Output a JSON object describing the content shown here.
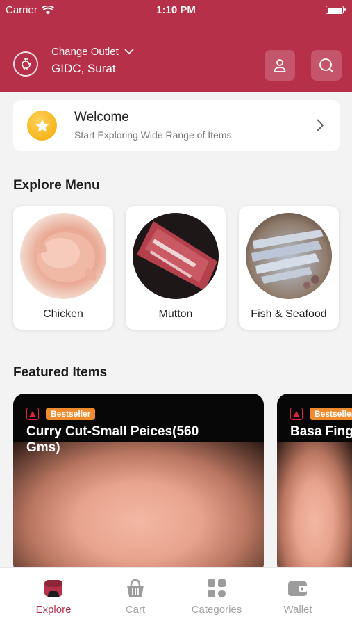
{
  "status": {
    "carrier": "Carrier",
    "time": "1:10 PM"
  },
  "header": {
    "outlet_label": "Change Outlet",
    "outlet_value": "GIDC, Surat"
  },
  "welcome": {
    "title": "Welcome",
    "subtitle": "Start Exploring Wide Range of Items"
  },
  "explore": {
    "title": "Explore Menu",
    "items": [
      {
        "label": "Chicken"
      },
      {
        "label": "Mutton"
      },
      {
        "label": "Fish & Seafood"
      }
    ]
  },
  "featured": {
    "title": "Featured Items",
    "items": [
      {
        "badge": "Bestseller",
        "title_line1": "Curry Cut-Small Peices(560",
        "title_line2": "Gms)"
      },
      {
        "badge": "Bestseller",
        "title_line1": "Basa Fing"
      }
    ]
  },
  "tabs": [
    {
      "label": "Explore",
      "active": true
    },
    {
      "label": "Cart",
      "active": false
    },
    {
      "label": "Categories",
      "active": false
    },
    {
      "label": "Wallet",
      "active": false
    }
  ],
  "colors": {
    "brand": "#b7304a",
    "badge": "#f08a2c",
    "star": "#f2a900"
  },
  "icons": [
    "wifi-icon",
    "battery-icon",
    "rooster-logo-icon",
    "chevron-down-icon",
    "user-icon",
    "search-icon",
    "star-icon",
    "chevron-right-icon",
    "nonveg-icon",
    "explore-icon",
    "cart-icon",
    "categories-icon",
    "wallet-icon"
  ]
}
